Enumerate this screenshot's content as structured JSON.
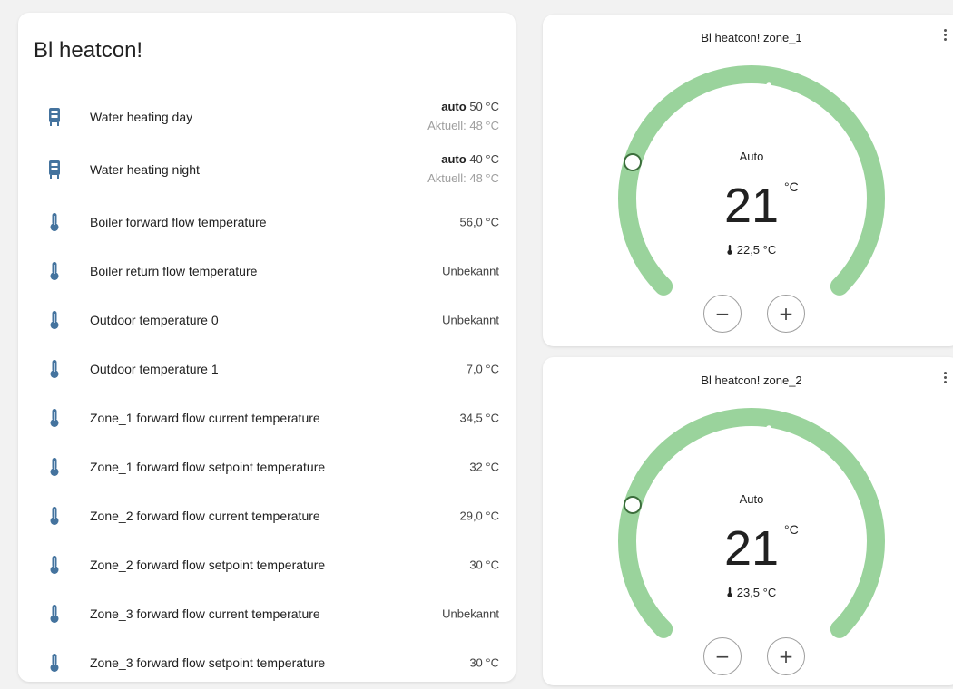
{
  "entities_card": {
    "title": "Bl heatcon!",
    "rows": [
      {
        "name": "Water heating day",
        "icon": "water-boiler-icon",
        "mode": "auto",
        "setpoint": "50 °C",
        "current": "Aktuell: 48 °C"
      },
      {
        "name": "Water heating night",
        "icon": "water-boiler-icon",
        "mode": "auto",
        "setpoint": "40 °C",
        "current": "Aktuell: 48 °C"
      },
      {
        "name": "Boiler forward flow temperature",
        "icon": "thermometer-icon",
        "state": "56,0 °C"
      },
      {
        "name": "Boiler return flow temperature",
        "icon": "thermometer-icon",
        "state": "Unbekannt"
      },
      {
        "name": "Outdoor temperature 0",
        "icon": "thermometer-icon",
        "state": "Unbekannt"
      },
      {
        "name": "Outdoor temperature 1",
        "icon": "thermometer-icon",
        "state": "7,0 °C"
      },
      {
        "name": "Zone_1 forward flow current temperature",
        "icon": "thermometer-icon",
        "state": "34,5 °C"
      },
      {
        "name": "Zone_1 forward flow setpoint temperature",
        "icon": "thermometer-icon",
        "state": "32 °C"
      },
      {
        "name": "Zone_2 forward flow current temperature",
        "icon": "thermometer-icon",
        "state": "29,0 °C"
      },
      {
        "name": "Zone_2 forward flow setpoint temperature",
        "icon": "thermometer-icon",
        "state": "30 °C"
      },
      {
        "name": "Zone_3 forward flow current temperature",
        "icon": "thermometer-icon",
        "state": "Unbekannt"
      },
      {
        "name": "Zone_3 forward flow setpoint temperature",
        "icon": "thermometer-icon",
        "state": "30 °C"
      }
    ]
  },
  "thermostats": [
    {
      "title": "Bl heatcon! zone_1",
      "mode": "Auto",
      "target": "21",
      "unit": "°C",
      "current": "22,5 °C",
      "minus": "−",
      "plus": "+"
    },
    {
      "title": "Bl heatcon! zone_2",
      "mode": "Auto",
      "target": "21",
      "unit": "°C",
      "current": "23,5 °C",
      "minus": "−",
      "plus": "+"
    }
  ],
  "colors": {
    "arc": "#9ad39c",
    "icon": "#44739e",
    "background": "#f2f2f2"
  }
}
